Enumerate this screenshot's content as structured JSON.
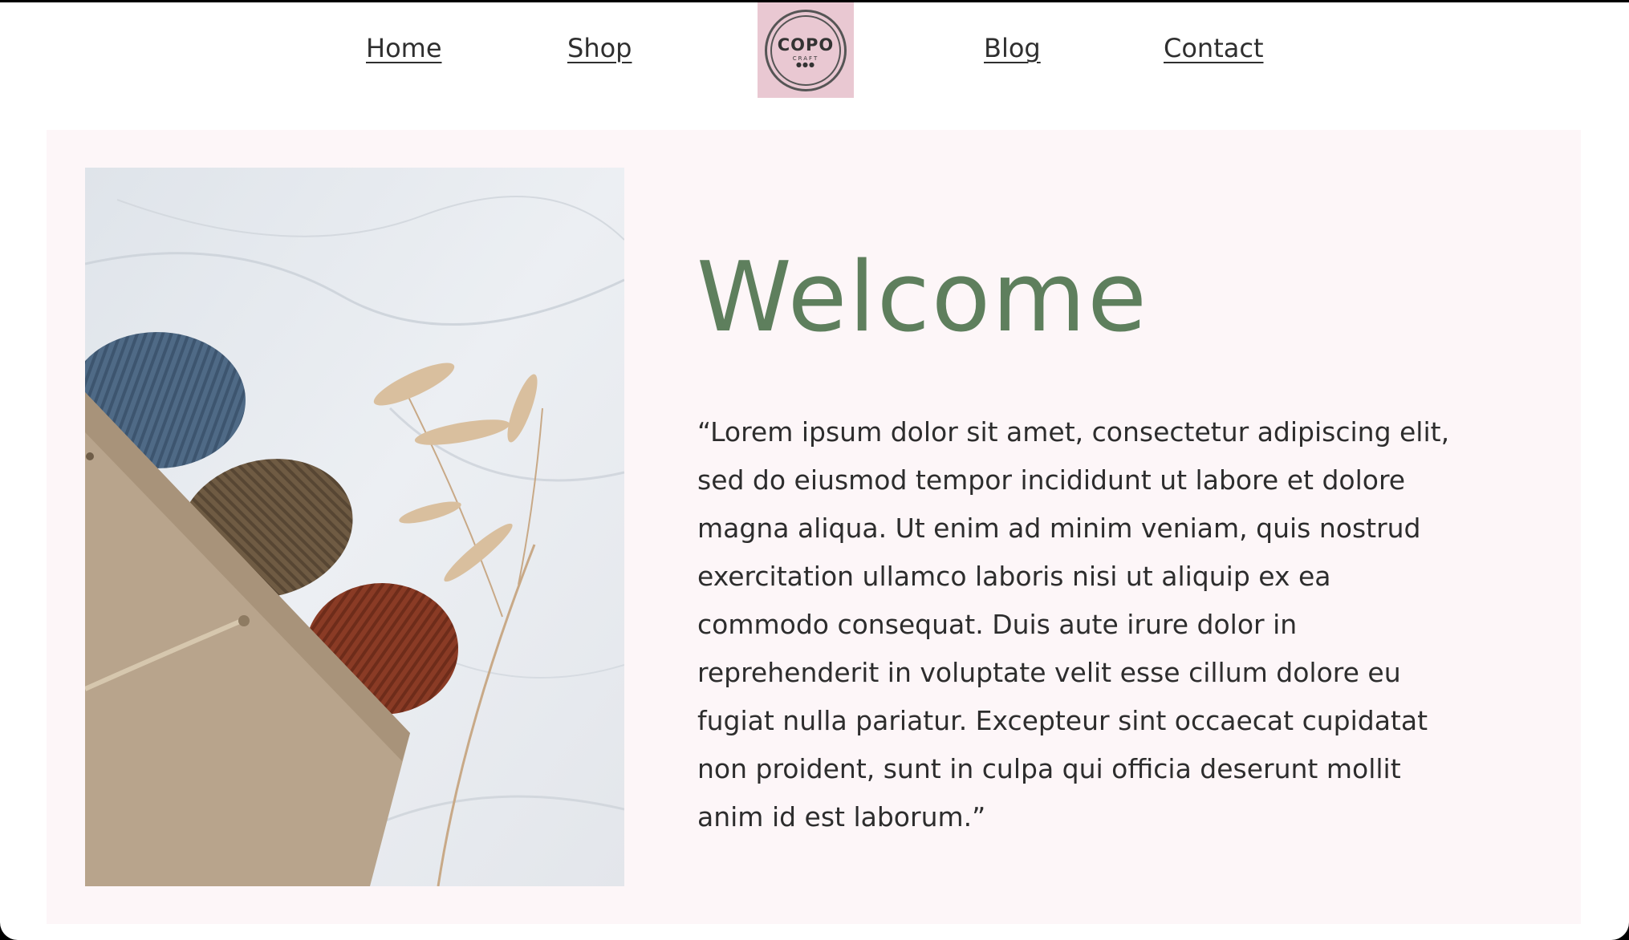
{
  "nav": {
    "items": [
      {
        "label": "Home"
      },
      {
        "label": "Shop"
      },
      {
        "label": "Blog"
      },
      {
        "label": "Contact"
      }
    ],
    "logo": {
      "text": "COPO",
      "subtext": "CRAFT",
      "background": "#e9c8d2"
    }
  },
  "hero": {
    "title": "Welcome",
    "title_color": "#5e7f5d",
    "body": "“Lorem ipsum dolor sit amet, consectetur adipiscing elit, sed do eiusmod tempor incididunt ut labore et dolore magna aliqua. Ut enim ad minim veniam, quis nostrud exercitation ullamco laboris nisi ut aliquip ex ea commodo consequat. Duis aute irure dolor in reprehenderit in voluptate velit esse cillum dolore eu fugiat nulla pariatur. Excepteur sint occaecat cupidatat non proident, sunt in culpa qui officia deserunt mollit anim id est laborum.”",
    "background": "#fdf6f8"
  }
}
